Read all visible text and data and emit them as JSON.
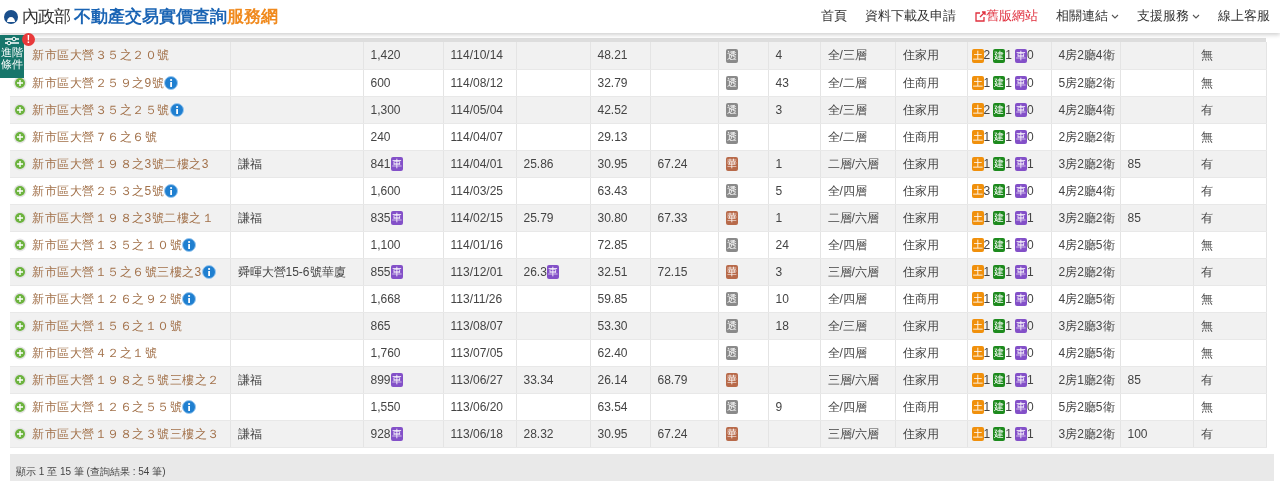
{
  "header": {
    "brand_ministry": "內政部",
    "brand_main": "不動產交易實價查詢",
    "brand_accent": "服務網",
    "nav": [
      {
        "label": "首頁",
        "kind": "link"
      },
      {
        "label": "資料下載及申請",
        "kind": "link"
      },
      {
        "label": "舊版網站",
        "kind": "external"
      },
      {
        "label": "相關連結",
        "kind": "dropdown"
      },
      {
        "label": "支援服務",
        "kind": "dropdown"
      },
      {
        "label": "線上客服",
        "kind": "link"
      }
    ]
  },
  "advanced_filter": {
    "label": "進階條件",
    "alert": "!"
  },
  "rows": [
    {
      "expand_icon": false,
      "address": "新市區大營３５之２０號",
      "info": false,
      "price": "1,420",
      "date": "114/10/14",
      "area": "48.21",
      "type_tag": {
        "label": "透",
        "color": "#8a8a8a"
      },
      "column_9": "4",
      "floor": "全/三層",
      "use": "住家用",
      "units": [
        {
          "kind": "land",
          "label": "土",
          "count": "2"
        },
        {
          "kind": "building",
          "label": "建",
          "count": "1"
        },
        {
          "kind": "parking",
          "label": "車",
          "count": "0"
        }
      ],
      "layout": "4房2廳4衛",
      "column_15": "無"
    },
    {
      "expand_icon": true,
      "address": "新市區大營２５９之9號",
      "info": true,
      "price": "600",
      "date": "114/08/12",
      "area": "32.79",
      "type_tag": {
        "label": "透",
        "color": "#8a8a8a"
      },
      "column_9": "43",
      "floor": "全/二層",
      "use": "住商用",
      "units": [
        {
          "kind": "land",
          "label": "土",
          "count": "1"
        },
        {
          "kind": "building",
          "label": "建",
          "count": "1"
        },
        {
          "kind": "parking",
          "label": "車",
          "count": "0"
        }
      ],
      "layout": "5房2廳2衛",
      "column_15": "無"
    },
    {
      "expand_icon": true,
      "address": "新市區大營３５之２５號",
      "info": true,
      "price": "1,300",
      "date": "114/05/04",
      "area": "42.52",
      "type_tag": {
        "label": "透",
        "color": "#8a8a8a"
      },
      "column_9": "3",
      "floor": "全/三層",
      "use": "住家用",
      "units": [
        {
          "kind": "land",
          "label": "土",
          "count": "2"
        },
        {
          "kind": "building",
          "label": "建",
          "count": "1"
        },
        {
          "kind": "parking",
          "label": "車",
          "count": "0"
        }
      ],
      "layout": "4房2廳4衛",
      "column_15": "有"
    },
    {
      "expand_icon": true,
      "address": "新市區大營７６之６號",
      "info": false,
      "price": "240",
      "date": "114/04/07",
      "area": "29.13",
      "type_tag": {
        "label": "透",
        "color": "#8a8a8a"
      },
      "floor": "全/二層",
      "use": "住商用",
      "units": [
        {
          "kind": "land",
          "label": "土",
          "count": "1"
        },
        {
          "kind": "building",
          "label": "建",
          "count": "1"
        },
        {
          "kind": "parking",
          "label": "車",
          "count": "0"
        }
      ],
      "layout": "2房2廳2衛",
      "column_15": "無"
    },
    {
      "expand_icon": true,
      "address": "新市區大營１９８之3號二樓之3",
      "info": false,
      "community": "謙福",
      "price": "841",
      "price_tag": "車",
      "date": "114/04/01",
      "column_5": "25.86",
      "area": "30.95",
      "column_7": "67.24",
      "type_tag": {
        "label": "華",
        "color": "#b86a4a"
      },
      "column_9": "1",
      "floor": "二層/六層",
      "use": "住家用",
      "units": [
        {
          "kind": "land",
          "label": "土",
          "count": "1"
        },
        {
          "kind": "building",
          "label": "建",
          "count": "1"
        },
        {
          "kind": "parking",
          "label": "車",
          "count": "1"
        }
      ],
      "layout": "3房2廳2衛",
      "column_14": "85",
      "column_15": "有"
    },
    {
      "expand_icon": true,
      "address": "新市區大營２５３之5號",
      "info": true,
      "price": "1,600",
      "date": "114/03/25",
      "area": "63.43",
      "type_tag": {
        "label": "透",
        "color": "#8a8a8a"
      },
      "column_9": "5",
      "floor": "全/四層",
      "use": "住家用",
      "units": [
        {
          "kind": "land",
          "label": "土",
          "count": "3"
        },
        {
          "kind": "building",
          "label": "建",
          "count": "1"
        },
        {
          "kind": "parking",
          "label": "車",
          "count": "0"
        }
      ],
      "layout": "4房2廳4衛",
      "column_15": "有"
    },
    {
      "expand_icon": true,
      "address": "新市區大營１９８之3號二樓之１",
      "info": false,
      "community": "謙福",
      "price": "835",
      "price_tag": "車",
      "date": "114/02/15",
      "column_5": "25.79",
      "area": "30.80",
      "column_7": "67.33",
      "type_tag": {
        "label": "華",
        "color": "#b86a4a"
      },
      "column_9": "1",
      "floor": "二層/六層",
      "use": "住家用",
      "units": [
        {
          "kind": "land",
          "label": "土",
          "count": "1"
        },
        {
          "kind": "building",
          "label": "建",
          "count": "1"
        },
        {
          "kind": "parking",
          "label": "車",
          "count": "1"
        }
      ],
      "layout": "3房2廳2衛",
      "column_14": "85",
      "column_15": "有"
    },
    {
      "expand_icon": true,
      "address": "新市區大營１３５之１０號",
      "info": true,
      "price": "1,100",
      "date": "114/01/16",
      "area": "72.85",
      "type_tag": {
        "label": "透",
        "color": "#8a8a8a"
      },
      "column_9": "24",
      "floor": "全/四層",
      "use": "住家用",
      "units": [
        {
          "kind": "land",
          "label": "土",
          "count": "2"
        },
        {
          "kind": "building",
          "label": "建",
          "count": "1"
        },
        {
          "kind": "parking",
          "label": "車",
          "count": "0"
        }
      ],
      "layout": "4房2廳5衛",
      "column_15": "無"
    },
    {
      "expand_icon": true,
      "address": "新市區大營１５之６號三樓之3",
      "info": true,
      "community": "舜暉大營15-6號華廈",
      "price": "855",
      "price_tag": "車",
      "date": "113/12/01",
      "column_5": "26.3",
      "column_5_tag": "車",
      "area": "32.51",
      "column_7": "72.15",
      "type_tag": {
        "label": "華",
        "color": "#b86a4a"
      },
      "column_9": "3",
      "floor": "三層/六層",
      "use": "住家用",
      "units": [
        {
          "kind": "land",
          "label": "土",
          "count": "1"
        },
        {
          "kind": "building",
          "label": "建",
          "count": "1"
        },
        {
          "kind": "parking",
          "label": "車",
          "count": "1"
        }
      ],
      "layout": "2房2廳2衛",
      "column_15": "有"
    },
    {
      "expand_icon": true,
      "address": "新市區大營１２６之９２號",
      "info": true,
      "price": "1,668",
      "date": "113/11/26",
      "area": "59.85",
      "type_tag": {
        "label": "透",
        "color": "#8a8a8a"
      },
      "column_9": "10",
      "floor": "全/四層",
      "use": "住商用",
      "units": [
        {
          "kind": "land",
          "label": "土",
          "count": "1"
        },
        {
          "kind": "building",
          "label": "建",
          "count": "1"
        },
        {
          "kind": "parking",
          "label": "車",
          "count": "0"
        }
      ],
      "layout": "4房2廳5衛",
      "column_15": "無"
    },
    {
      "expand_icon": true,
      "address": "新市區大營１５６之１０號",
      "info": false,
      "price": "865",
      "date": "113/08/07",
      "area": "53.30",
      "type_tag": {
        "label": "透",
        "color": "#8a8a8a"
      },
      "column_9": "18",
      "floor": "全/三層",
      "use": "住家用",
      "units": [
        {
          "kind": "land",
          "label": "土",
          "count": "1"
        },
        {
          "kind": "building",
          "label": "建",
          "count": "1"
        },
        {
          "kind": "parking",
          "label": "車",
          "count": "0"
        }
      ],
      "layout": "3房2廳3衛",
      "column_15": "無"
    },
    {
      "expand_icon": true,
      "address": "新市區大營４２之１號",
      "info": false,
      "price": "1,760",
      "date": "113/07/05",
      "area": "62.40",
      "type_tag": {
        "label": "透",
        "color": "#8a8a8a"
      },
      "floor": "全/四層",
      "use": "住家用",
      "units": [
        {
          "kind": "land",
          "label": "土",
          "count": "1"
        },
        {
          "kind": "building",
          "label": "建",
          "count": "1"
        },
        {
          "kind": "parking",
          "label": "車",
          "count": "0"
        }
      ],
      "layout": "4房2廳5衛",
      "column_15": "無"
    },
    {
      "expand_icon": true,
      "address": "新市區大營１９８之５號三樓之２",
      "info": false,
      "community": "謙福",
      "price": "899",
      "price_tag": "車",
      "date": "113/06/27",
      "column_5": "33.34",
      "area": "26.14",
      "column_7": "68.79",
      "type_tag": {
        "label": "華",
        "color": "#b86a4a"
      },
      "floor": "三層/六層",
      "use": "住家用",
      "units": [
        {
          "kind": "land",
          "label": "土",
          "count": "1"
        },
        {
          "kind": "building",
          "label": "建",
          "count": "1"
        },
        {
          "kind": "parking",
          "label": "車",
          "count": "1"
        }
      ],
      "layout": "2房1廳2衛",
      "column_14": "85",
      "column_15": "有"
    },
    {
      "expand_icon": true,
      "address": "新市區大營１２６之５５號",
      "info": true,
      "price": "1,550",
      "date": "113/06/20",
      "area": "63.54",
      "type_tag": {
        "label": "透",
        "color": "#8a8a8a"
      },
      "column_9": "9",
      "floor": "全/四層",
      "use": "住商用",
      "units": [
        {
          "kind": "land",
          "label": "土",
          "count": "1"
        },
        {
          "kind": "building",
          "label": "建",
          "count": "1"
        },
        {
          "kind": "parking",
          "label": "車",
          "count": "0"
        }
      ],
      "layout": "5房2廳5衛",
      "column_15": "無"
    },
    {
      "expand_icon": true,
      "address": "新市區大營１９８之３號三樓之３",
      "info": false,
      "community": "謙福",
      "price": "928",
      "price_tag": "車",
      "date": "113/06/18",
      "column_5": "28.32",
      "area": "30.95",
      "column_7": "67.24",
      "type_tag": {
        "label": "華",
        "color": "#b86a4a"
      },
      "floor": "三層/六層",
      "use": "住家用",
      "units": [
        {
          "kind": "land",
          "label": "土",
          "count": "1"
        },
        {
          "kind": "building",
          "label": "建",
          "count": "1"
        },
        {
          "kind": "parking",
          "label": "車",
          "count": "1"
        }
      ],
      "layout": "3房2廳2衛",
      "column_14": "100",
      "column_15": "有"
    }
  ],
  "footer": {
    "summary": "顯示 1 至 15 筆 (查詢結果 : 54 筆)"
  }
}
